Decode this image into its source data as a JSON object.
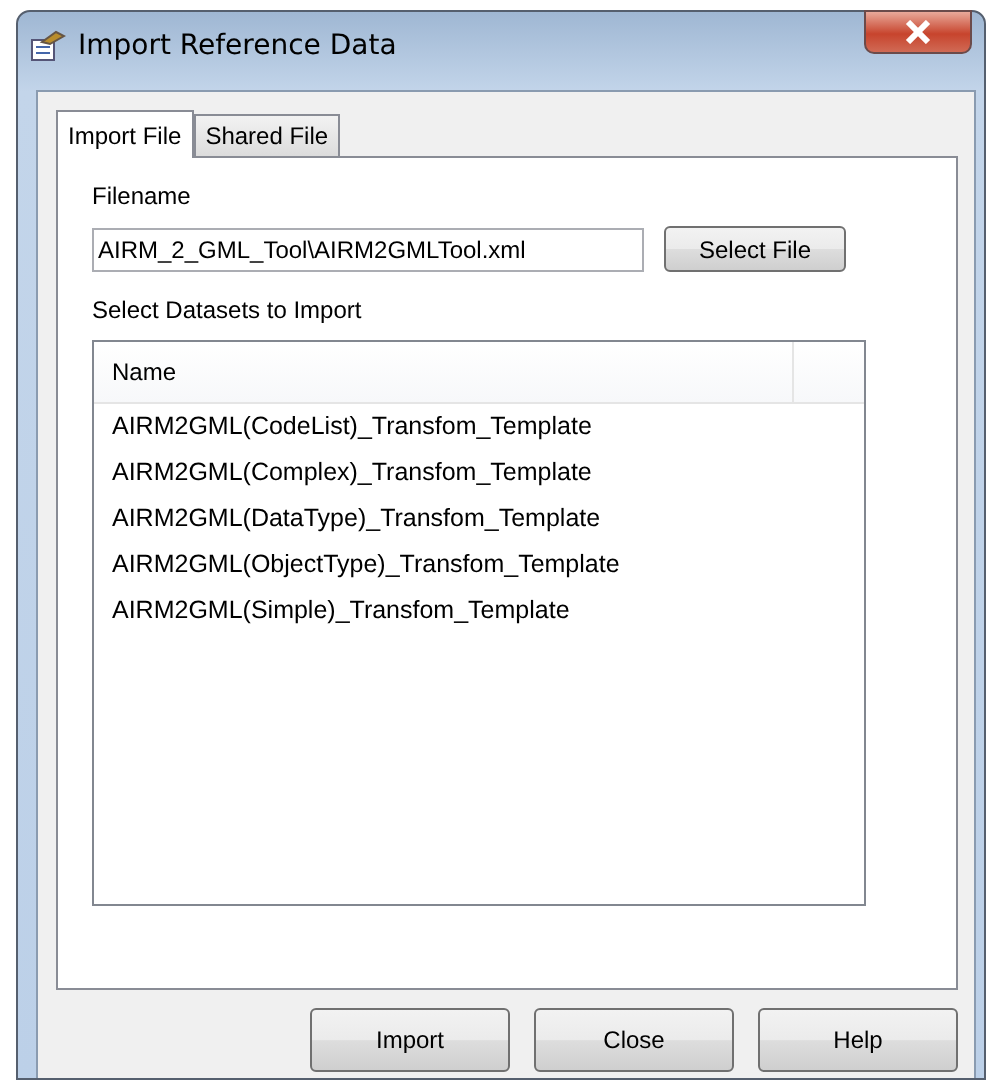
{
  "window": {
    "title": "Import Reference Data"
  },
  "tabs": [
    {
      "label": "Import File",
      "selected": true
    },
    {
      "label": "Shared File",
      "selected": false
    }
  ],
  "filename": {
    "label": "Filename",
    "value": "AIRM_2_GML_Tool\\AIRM2GMLTool.xml",
    "button": "Select File"
  },
  "datasets": {
    "label": "Select Datasets to Import",
    "columns": [
      "Name"
    ],
    "rows": [
      "AIRM2GML(CodeList)_Transfom_Template",
      "AIRM2GML(Complex)_Transfom_Template",
      "AIRM2GML(DataType)_Transfom_Template",
      "AIRM2GML(ObjectType)_Transfom_Template",
      "AIRM2GML(Simple)_Transfom_Template"
    ]
  },
  "buttons": [
    "Import",
    "Close",
    "Help"
  ]
}
